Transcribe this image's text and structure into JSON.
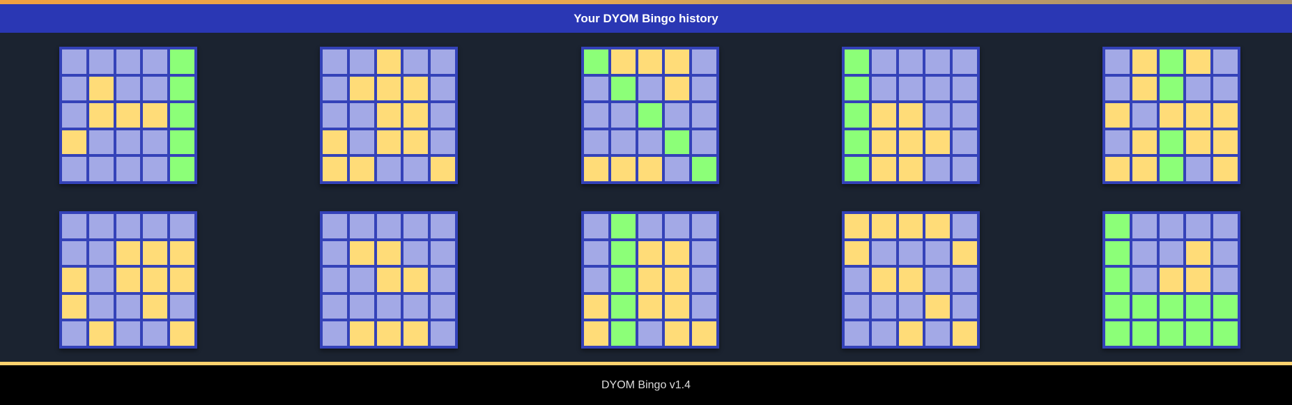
{
  "header": {
    "title": "Your DYOM Bingo history"
  },
  "footer": {
    "version_text": "DYOM Bingo v1.4"
  },
  "colors": {
    "unmarked": "#a3a9e6",
    "marked": "#ffdc78",
    "bingo_line": "#8cff78",
    "board_border": "#3442b8",
    "title_bar": "#2a37b4",
    "background": "#1b2330"
  },
  "cell_legend": {
    "n": "unmarked",
    "y": "marked",
    "g": "bingo-line"
  },
  "boards": [
    {
      "cells": [
        "nnnng",
        "nynng",
        "nyyyg",
        "ynnng",
        "nnnng"
      ]
    },
    {
      "cells": [
        "nnynn",
        "nyyyn",
        "nnyyn",
        "ynyyn",
        "yynny"
      ]
    },
    {
      "cells": [
        "gyyyn",
        "ngnyn",
        "nngnn",
        "nnngn",
        "yyyng"
      ]
    },
    {
      "cells": [
        "gnnnn",
        "gnnnn",
        "gyynn",
        "gyyyn",
        "gyynn"
      ]
    },
    {
      "cells": [
        "nygyn",
        "nygnn",
        "ynyyy",
        "nygyy",
        "yygny"
      ]
    },
    {
      "cells": [
        "nnnnn",
        "nnyyy",
        "ynyyy",
        "ynnyn",
        "nynny"
      ]
    },
    {
      "cells": [
        "nnnnn",
        "nyynn",
        "nnyyn",
        "nnnnn",
        "nyyyn"
      ]
    },
    {
      "cells": [
        "ngnnn",
        "ngyyn",
        "ngyyn",
        "ygyyn",
        "ygnyy"
      ]
    },
    {
      "cells": [
        "yyyyn",
        "ynnny",
        "nyynn",
        "nnnyn",
        "nnyny"
      ]
    },
    {
      "cells": [
        "gnnnn",
        "gnnyn",
        "gnyyn",
        "ggggg",
        "ggggg"
      ]
    }
  ]
}
